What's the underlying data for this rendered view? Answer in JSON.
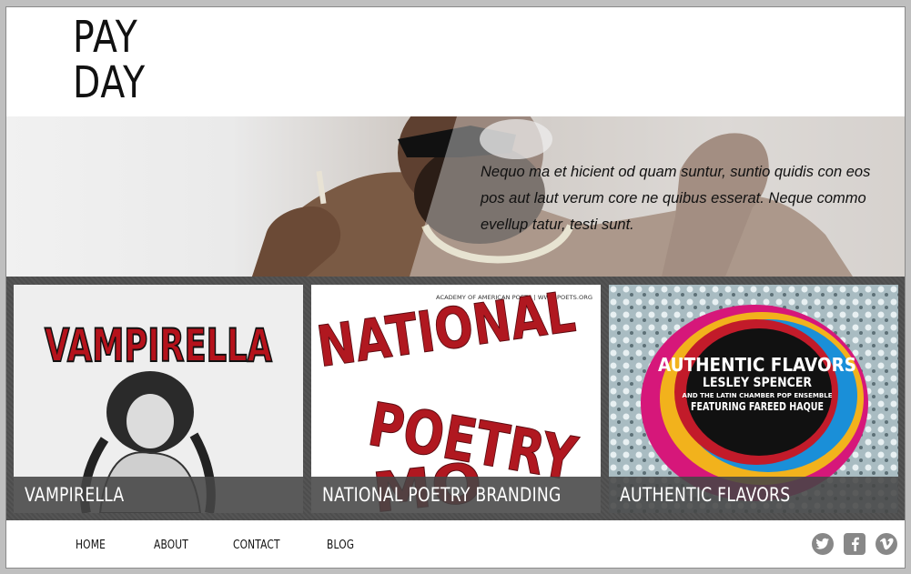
{
  "logo": {
    "line1": "PAY",
    "line2": "DAY"
  },
  "hero": {
    "text": "Nequo ma et hicient od quam suntur, suntio quidis con eos pos aut laut verum core ne quibus esserat. Neque commo evellup tatur, testi sunt."
  },
  "projects": [
    {
      "title": "VAMPIRELLA",
      "art_title": "VAMPIRELLA"
    },
    {
      "title": "NATIONAL POETRY BRANDING",
      "art_header": "ACADEMY OF AMERICAN POETS | WWW.POETS.ORG",
      "art_words": [
        "NATIONAL",
        "POETRY",
        "MO"
      ]
    },
    {
      "title": "AUTHENTIC FLAVORS",
      "art_title": "AUTHENTIC FLAVORS",
      "art_artist": "LESLEY SPENCER",
      "art_line": "AND THE LATIN CHAMBER POP ENSEMBLE",
      "art_feature": "FEATURING FAREED HAQUE"
    }
  ],
  "nav": {
    "home": "HOME",
    "about": "ABOUT",
    "contact": "CONTACT",
    "blog": "BLOG"
  },
  "social": [
    {
      "icon": "twitter-icon"
    },
    {
      "icon": "facebook-icon"
    },
    {
      "icon": "vimeo-icon"
    }
  ]
}
